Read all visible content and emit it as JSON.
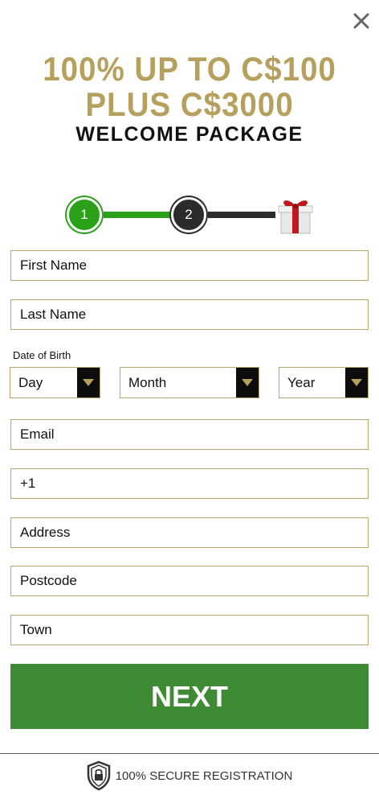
{
  "promo": {
    "line1": "100% UP TO C$100",
    "line2": "PLUS C$3000",
    "line3": "WELCOME PACKAGE"
  },
  "stepper": {
    "step1": "1",
    "step2": "2",
    "current_step": 1,
    "final_icon": "gift-icon"
  },
  "form": {
    "first_name_placeholder": "First Name",
    "last_name_placeholder": "Last Name",
    "dob_label": "Date of Birth",
    "day": "Day",
    "month": "Month",
    "year": "Year",
    "email_placeholder": "Email",
    "phone_value": "+1",
    "address_placeholder": "Address",
    "postcode_placeholder": "Postcode",
    "town_placeholder": "Town"
  },
  "next_label": "NEXT",
  "footer": {
    "secure_text": "100% SECURE REGISTRATION",
    "icon": "shield-lock-icon"
  },
  "colors": {
    "gold": "#b5a05e",
    "green": "#2ba11a",
    "button_green": "#3f8a35",
    "dark": "#2b2b2b",
    "border": "#b5a76b"
  }
}
